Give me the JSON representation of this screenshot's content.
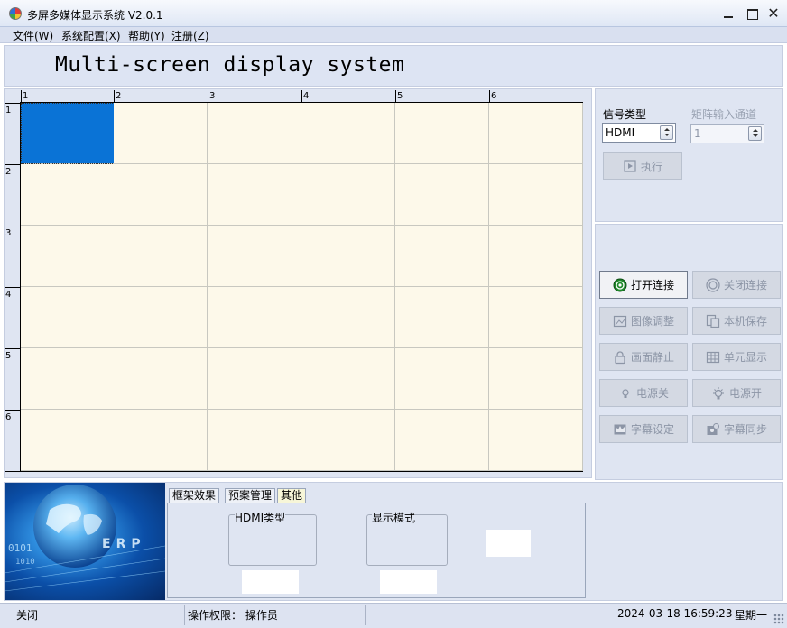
{
  "window": {
    "title": "多屏多媒体显示系统 V2.0.1"
  },
  "menu": {
    "items": [
      "文件(W)",
      "系统配置(X)",
      "帮助(Y)",
      "注册(Z)"
    ]
  },
  "banner": {
    "title": "Multi-screen display system"
  },
  "grid": {
    "columns": [
      "1",
      "2",
      "3",
      "4",
      "5",
      "6"
    ],
    "rows": [
      "1",
      "2",
      "3",
      "4",
      "5",
      "6"
    ],
    "selected_cell": "1-1"
  },
  "signal_panel": {
    "signal_type_label": "信号类型",
    "signal_type_value": "HDMI",
    "matrix_input_label": "矩阵输入通道",
    "matrix_input_value": "1",
    "execute_label": "执行"
  },
  "control_buttons": {
    "open_connection": "打开连接",
    "close_connection": "关闭连接",
    "image_adjust": "图像调整",
    "local_save": "本机保存",
    "picture_freeze": "画面静止",
    "unit_display": "单元显示",
    "power_off": "电源关",
    "power_on": "电源开",
    "caption_settings": "字幕设定",
    "caption_sync": "字幕同步"
  },
  "bottom": {
    "tabs": [
      "框架效果",
      "预案管理",
      "其他"
    ],
    "active_tab": "其他",
    "hdmi_type_label": "HDMI类型",
    "display_mode_label": "显示模式",
    "image_text": "ERP"
  },
  "status": {
    "left": "关闭",
    "permission": "操作权限： 操作员",
    "datetime": "2024-03-18 16:59:23",
    "weekday": "星期一"
  },
  "colors": {
    "grid_cell": "#fdf9ea",
    "selected_cell": "#0a73d6",
    "panel_bg": "#dfe5f2"
  }
}
